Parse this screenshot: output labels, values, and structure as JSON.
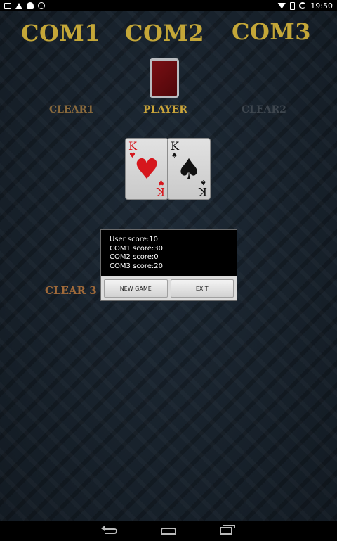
{
  "status_bar": {
    "time": "19:50",
    "left_icons": [
      "photo-icon",
      "warning-icon",
      "android-icon",
      "game-icon"
    ],
    "right_icons": [
      "wifi-icon",
      "battery-icon",
      "sync-icon"
    ]
  },
  "table": {
    "com1_label": "COM1",
    "com2_label": "COM2",
    "com3_label": "COM3",
    "clear1_label": "CLEAR1",
    "player_label": "PLAYER",
    "clear2_label": "CLEAR2",
    "clear3_label": "CLEAR 3"
  },
  "cards": [
    {
      "rank": "K",
      "suit": "♥",
      "color": "#d6171d"
    },
    {
      "rank": "K",
      "suit": "♠",
      "color": "#111111"
    }
  ],
  "dialog": {
    "lines": [
      "User score:10",
      "COM1 score:30",
      "COM2 score:0",
      "COM3 score:20"
    ],
    "new_game_label": "NEW GAME",
    "exit_label": "EXIT"
  },
  "colors": {
    "gold": "#c4a738",
    "clear3": "#a06a3a",
    "background": "#16202a"
  }
}
